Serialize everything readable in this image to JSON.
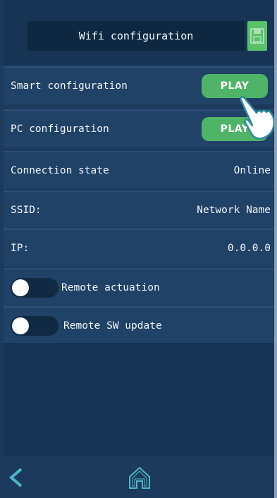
{
  "header": {
    "title": "Wifi configuration",
    "save_icon": "floppy-disk-icon"
  },
  "rows": {
    "smart_config": {
      "label": "Smart configuration",
      "button": "PLAY"
    },
    "pc_config": {
      "label": "PC configuration",
      "button": "PLAY"
    },
    "connection_state": {
      "label": "Connection state",
      "value": "Online"
    },
    "ssid": {
      "label": "SSID:",
      "value": "Network Name"
    },
    "ip": {
      "label": "IP:",
      "value": "0.0.0.0"
    },
    "remote_actuation": {
      "label": "Remote actuation",
      "on": false
    },
    "remote_sw_update": {
      "label": "Remote SW update",
      "on": false
    }
  },
  "footer": {
    "back_icon": "chevron-left-icon",
    "home_icon": "home-icon"
  },
  "colors": {
    "accent_green": "#4fb468",
    "background": "#1b3a5c",
    "icon_teal": "#4fb8c8"
  }
}
